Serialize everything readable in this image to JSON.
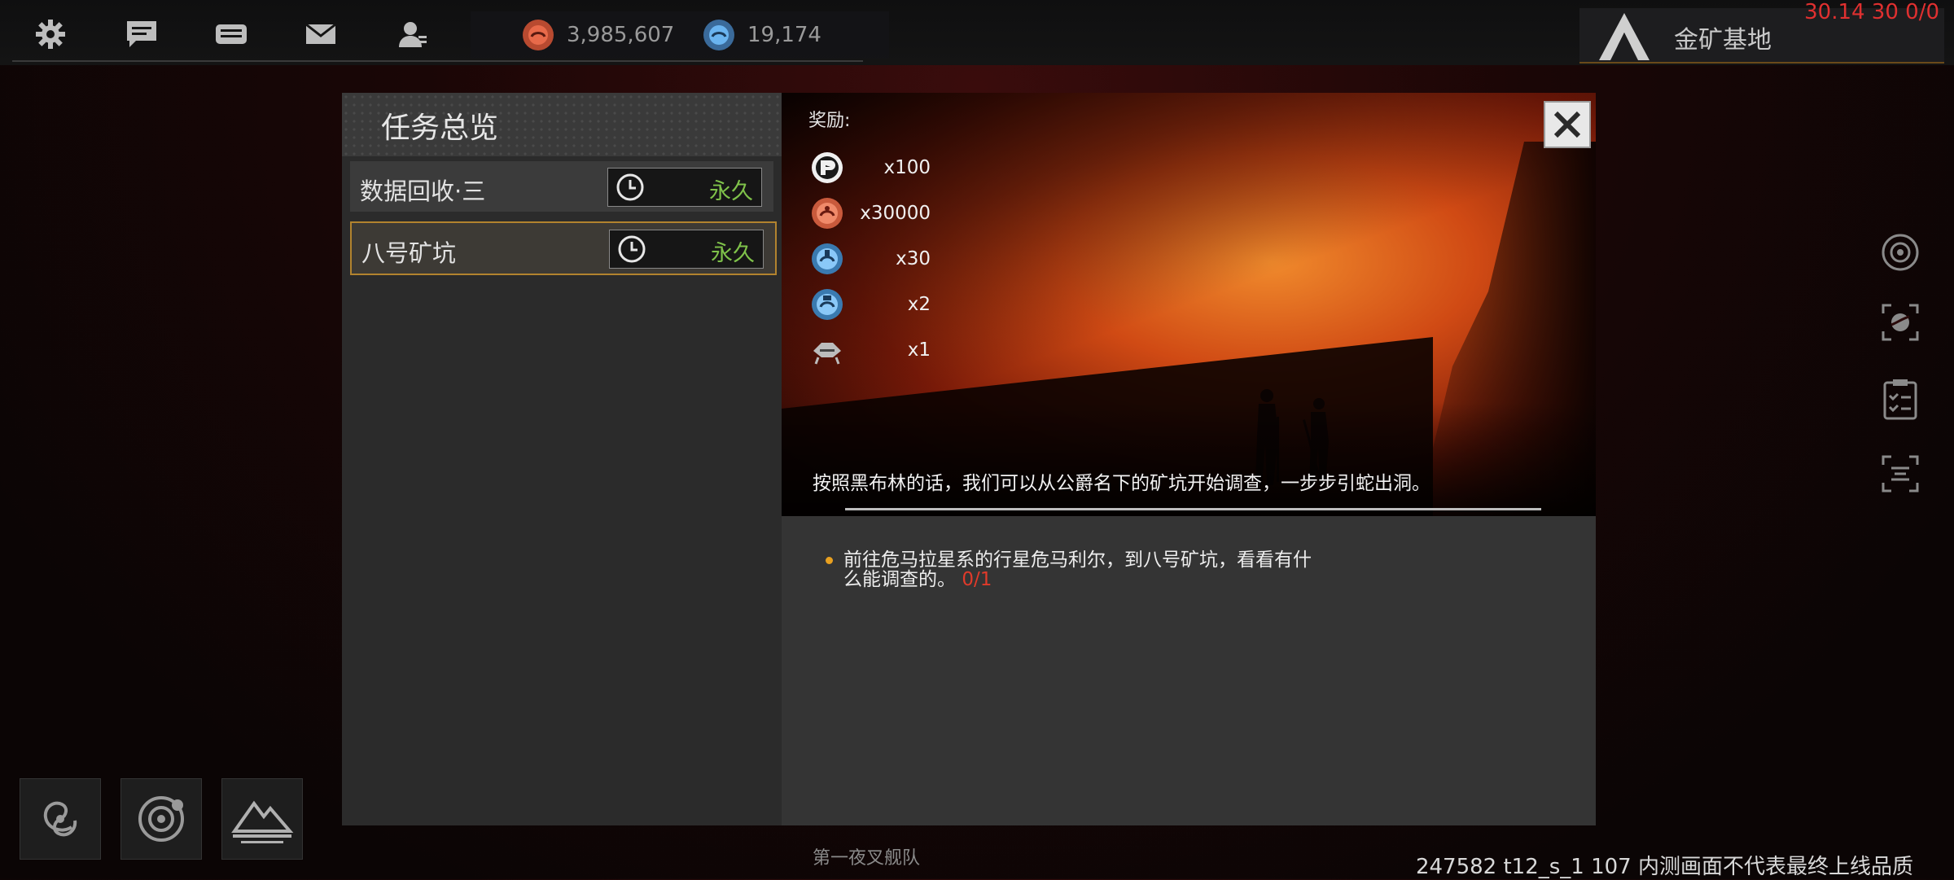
{
  "topbar": {
    "icons": [
      "gear-icon",
      "chat-icon",
      "mail-bubble-icon",
      "envelope-icon",
      "person-icon"
    ],
    "resources": [
      {
        "name": "credits-icon",
        "value": "3,985,607",
        "color": "#e05a3a"
      },
      {
        "name": "crystal-icon",
        "value": "19,174",
        "color": "#5aa0e0"
      }
    ],
    "base_name": "金矿基地"
  },
  "debug_top": "30.14 30 0/0",
  "debug_bottom": "247582 t12_s_1 107 内测画面不代表最终上线品质",
  "fleet_label": "第一夜叉舰队",
  "quest_panel": {
    "title": "任务总览",
    "quests": [
      {
        "name": "数据回收·三",
        "duration": "永久",
        "selected": false
      },
      {
        "name": "八号矿坑",
        "duration": "永久",
        "selected": true
      }
    ]
  },
  "detail": {
    "reward_label": "奖励:",
    "rewards": [
      {
        "icon": "reputation-icon",
        "qty": "x100",
        "color": "#ffffff"
      },
      {
        "icon": "credits-icon",
        "qty": "x30000",
        "color": "#e86a4a"
      },
      {
        "icon": "crystal-icon",
        "qty": "x30",
        "color": "#6ab4f0"
      },
      {
        "icon": "crystal-icon",
        "qty": "x2",
        "color": "#6ab4f0"
      },
      {
        "icon": "ship-blueprint-icon",
        "qty": "x1",
        "color": "#cccccc"
      }
    ],
    "description": "按照黑布林的话，我们可以从公爵名下的矿坑开始调查，一步步引蛇出洞。",
    "objective": {
      "text": "前往危马拉星系的行星危马利尔，到八号矿坑，看看有什么能调查的。",
      "progress": "0/1"
    }
  },
  "bottom_buttons": [
    "galaxy-icon",
    "star-system-icon",
    "planet-base-icon"
  ],
  "side_icons": [
    "radar-icon",
    "planet-scan-icon",
    "clipboard-icon",
    "filter-icon"
  ]
}
